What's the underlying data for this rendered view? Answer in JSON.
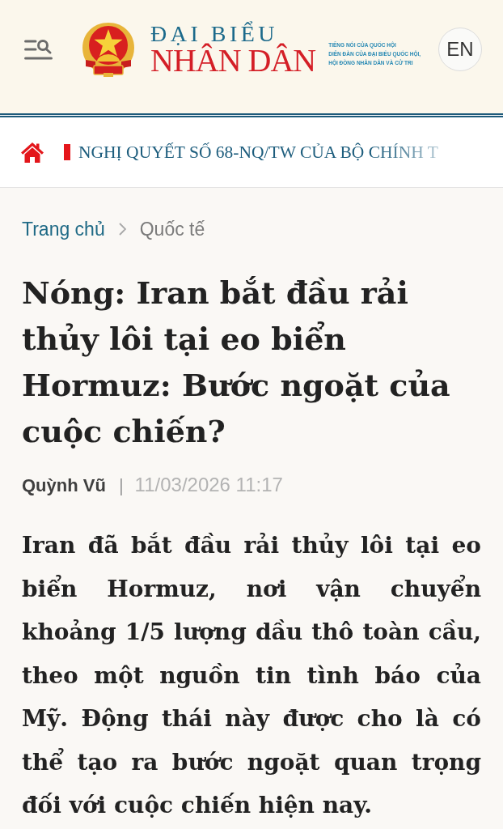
{
  "header": {
    "logo": {
      "line_1": "ĐẠI BIỂU",
      "line_2": "NHÂN DÂN"
    },
    "tagline": [
      "TIẾNG NÓI CỦA QUỐC HỘI",
      "DIỄN ĐÀN CỦA ĐẠI BIỂU QUỐC HỘI,",
      "HỘI ĐỒNG NHÂN DÂN VÀ CỬ TRI"
    ],
    "language_button": "EN"
  },
  "ticker": {
    "headline": "NGHỊ QUYẾT SỐ 68-NQ/TW CỦA BỘ CHÍNH T"
  },
  "breadcrumb": [
    {
      "label": "Trang chủ",
      "kind": "link"
    },
    {
      "label": "Quốc tế",
      "kind": "current"
    }
  ],
  "article": {
    "title": "Nóng: Iran bắt đầu rải thủy lôi tại eo biển Hormuz: Bước ngoặt của cuộc chiến?",
    "author": "Quỳnh Vũ",
    "byline_separator": "|",
    "published": "11/03/2026 11:17",
    "lead": "Iran đã bắt đầu rải thủy lôi tại eo biển Hormuz, nơi vận chuyển khoảng 1/5 lượng dầu thô toàn cầu, theo một nguồn tin tình báo của Mỹ. Động thái này được cho là có thể tạo ra bước ngoặt quan trọng đối với cuộc chiến hiện nay."
  }
}
